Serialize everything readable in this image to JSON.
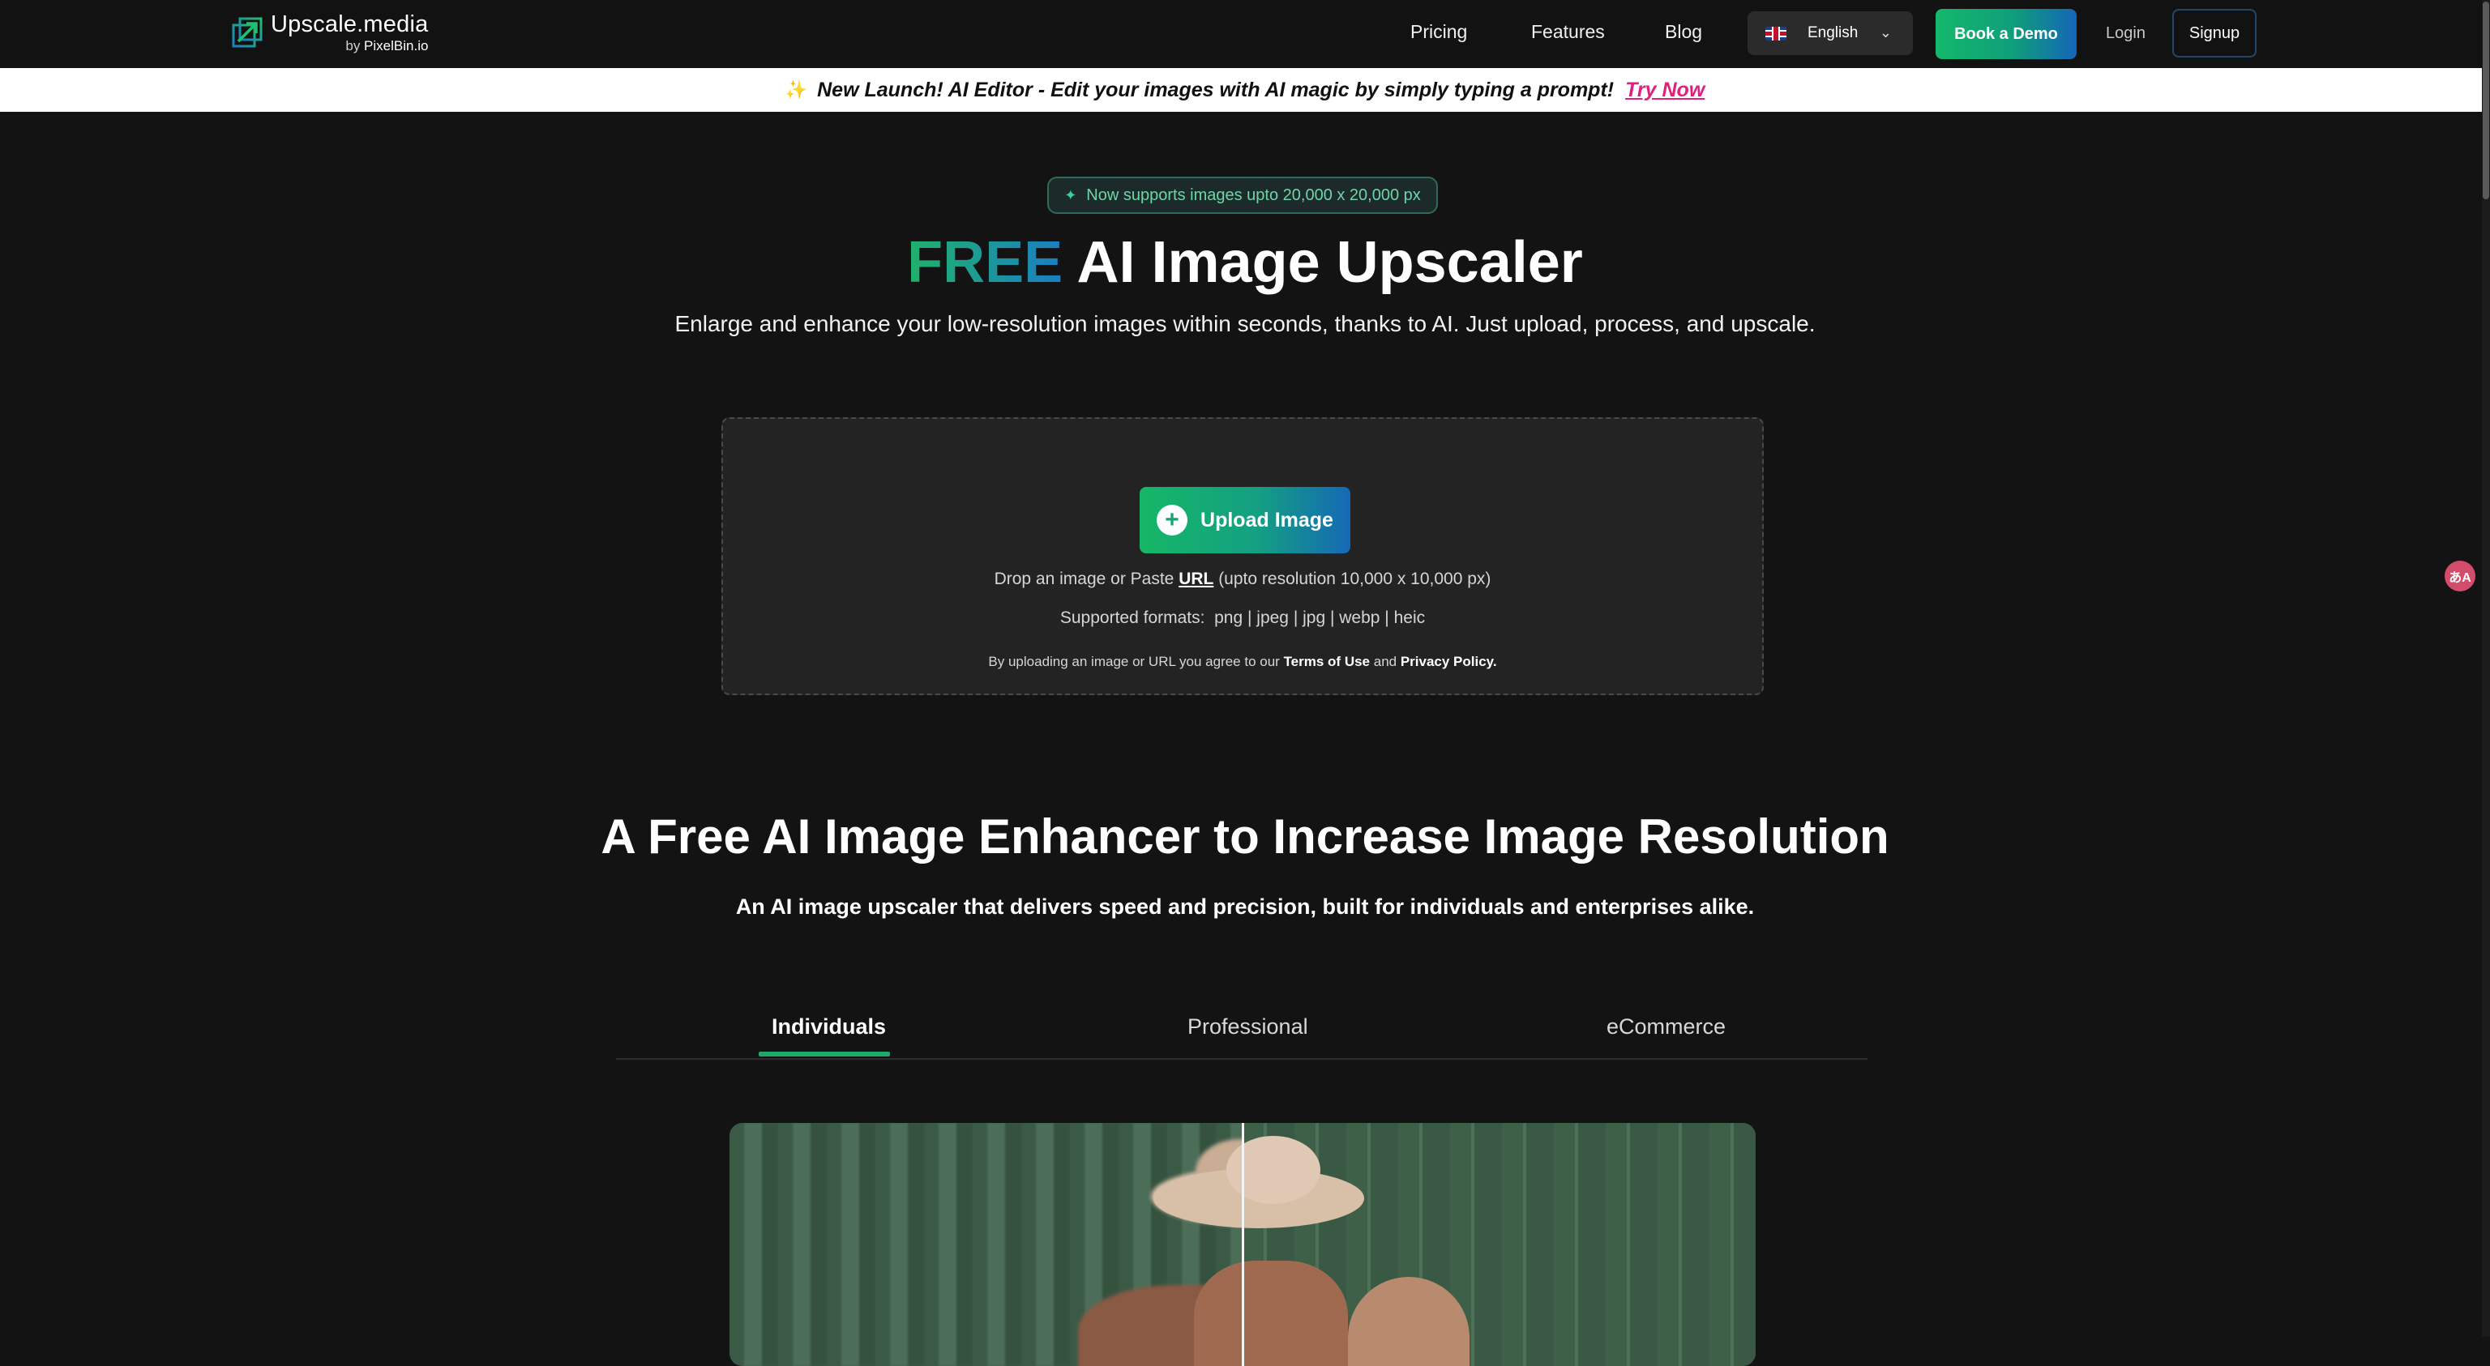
{
  "header": {
    "logo": {
      "name": "Upscale.media",
      "by_prefix": "by ",
      "by_brand": "PixelBin.io"
    },
    "nav": [
      {
        "label": "Pricing"
      },
      {
        "label": "Features"
      },
      {
        "label": "Blog"
      }
    ],
    "language": {
      "label": "English"
    },
    "book_demo_label": "Book a Demo",
    "login_label": "Login",
    "signup_label": "Signup"
  },
  "announcement": {
    "text": "New Launch! AI Editor - Edit your images with AI magic by simply typing a prompt!",
    "cta": "Try Now"
  },
  "hero": {
    "pill_text": "Now supports images upto 20,000 x 20,000 px",
    "title_highlight": "FREE",
    "title_rest": " AI Image Upscaler",
    "subtitle": "Enlarge and enhance your low-resolution images within seconds, thanks to AI. Just upload, process, and upscale."
  },
  "upload": {
    "button_label": "Upload Image",
    "drop_prefix": "Drop an image or Paste ",
    "drop_url": "URL",
    "drop_suffix": " (upto resolution 10,000 x 10,000 px)",
    "formats_label": "Supported formats:",
    "formats_list": "png | jpeg | jpg | webp | heic",
    "agree_prefix": "By uploading an image or URL you agree to our ",
    "terms": "Terms of Use",
    "agree_and": " and ",
    "privacy": "Privacy Policy."
  },
  "section": {
    "title": "A Free AI Image Enhancer to Increase Image Resolution",
    "subtitle": "An AI image upscaler that delivers speed and precision, built for individuals and enterprises alike.",
    "tabs": [
      {
        "label": "Individuals",
        "active": true
      },
      {
        "label": "Professional",
        "active": false
      },
      {
        "label": "eCommerce",
        "active": false
      }
    ]
  },
  "colors": {
    "accent_green": "#1fa86a",
    "accent_blue": "#1466b8",
    "background": "#131313",
    "try_now": "#e0207a"
  },
  "icons": {
    "logo": "upscale-arrow-icon",
    "language_flag": "uk-flag-icon",
    "chevron": "chevron-down-icon",
    "upload": "plus-circle-icon",
    "pill": "sparkle-icon",
    "announcement": "sparkle-icon",
    "floating": "translate-icon"
  }
}
